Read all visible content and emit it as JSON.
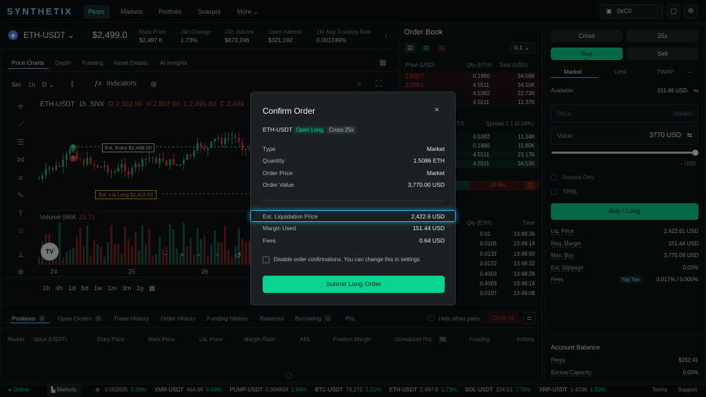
{
  "brand": "SYNTHETIX",
  "nav": [
    "Perps",
    "Markets",
    "Portfolio",
    "Snaxpot",
    "More"
  ],
  "wallet": "0xC0",
  "market": {
    "symbol": "ETH-USDT",
    "price": "$2,499.0",
    "stats": [
      {
        "label": "Mark Price",
        "value": "$2,497.6"
      },
      {
        "label": "24h Change",
        "value": "1.73%"
      },
      {
        "label": "24h Volume",
        "value": "$870,246"
      },
      {
        "label": "Open Interest",
        "value": "$321,192"
      },
      {
        "label": "1hr Avg. Funding Rate",
        "value": "0.001249%"
      }
    ]
  },
  "chart_tabs": [
    "Price Charts",
    "Depth",
    "Funding",
    "Asset Details",
    "AI Insights"
  ],
  "chart_toolbar": {
    "intervals": [
      "5m",
      "1h",
      "D"
    ],
    "indicators": "Indicators"
  },
  "chart_legend": {
    "pair": "ETH-USDT",
    "tf": "1h",
    "ex": "SNX",
    "o": "O 2,502.60",
    "h": "H 2,507.90",
    "l": "L 2,496.60",
    "c": "C 2,499"
  },
  "chart_markers": {
    "entry": "Est. Entry $2,499.00",
    "liq": "Est. Liq Long $2,422.61",
    "b": "B",
    "s": "S"
  },
  "volume_label": "Volume SMA",
  "volume_value": "21.71",
  "date_ticks": [
    "24",
    "25",
    "26"
  ],
  "ranges": [
    "1h",
    "4h",
    "1d",
    "5d",
    "1w",
    "1m",
    "3m",
    "1y"
  ],
  "orderbook": {
    "title": "Order Book",
    "step": "0.1",
    "headers": [
      "Price (USD)",
      "Qty (ETH)",
      "Total (USD)"
    ],
    "asks": [
      [
        "2,500.7",
        "0.1860",
        "34.56K"
      ],
      [
        "2,500.1",
        "4.5511",
        "34.10K"
      ],
      [
        "",
        "4.5382",
        "22.72K"
      ],
      [
        "",
        "4.5511",
        "11.37K"
      ]
    ],
    "spread_left": "7.6",
    "spread": "Spread 1.1 (0.04%)",
    "bids": [
      [
        "",
        "4.5382",
        "11.34K"
      ],
      [
        "",
        "0.1860",
        "11.80K"
      ],
      [
        "",
        "4.5511",
        "23.17K"
      ],
      [
        "",
        "4.5511",
        "34.53K"
      ]
    ],
    "ratio": "49.9%",
    "ratio_label": "S"
  },
  "trades": {
    "headers": [
      "Qty (ETH)",
      "Time"
    ],
    "rows": [
      [
        "0.01",
        "13:49:36"
      ],
      [
        "0.0105",
        "13:49:14"
      ],
      [
        "0.0132",
        "13:48:50"
      ],
      [
        "0.0122",
        "13:48:32"
      ],
      [
        "0.4003",
        "13:48:28"
      ],
      [
        "0.4003",
        "13:48:14"
      ],
      [
        "0.0107",
        "13:49:08"
      ]
    ]
  },
  "order_panel": {
    "margin_mode": "Cross",
    "leverage": "25x",
    "buy": "Buy",
    "sell": "Sell",
    "types": [
      "Market",
      "Limit",
      "TWAP"
    ],
    "available_label": "Available",
    "available": "151.66 USD",
    "price_placeholder": "Price",
    "price_market": "Market",
    "value_label": "Value",
    "value": "3770",
    "value_unit": "USD",
    "slider_unit": "-- USD",
    "reduce_only": "Reduce Only",
    "tpsl": "TP/SL",
    "submit": "Buy / Long",
    "rows": [
      [
        "Liq. Price",
        "2,422.61 USD"
      ],
      [
        "Req. Margin",
        "151.44 USD"
      ],
      [
        "Max. Buy",
        "3,775.09 USD"
      ],
      [
        "Est. Slippage",
        "0.02%"
      ]
    ],
    "fees_label": "Fees",
    "fees_tier": "Top Tier",
    "fees": "0.017% / 0.000%"
  },
  "account": {
    "title": "Account Balance",
    "perps_label": "Perps",
    "perps": "$152.41",
    "borrow_label": "Borrow Capacity",
    "borrow": "0.00%"
  },
  "positions": {
    "tabs": [
      {
        "label": "Positions",
        "count": "0"
      },
      {
        "label": "Open Orders",
        "count": "0"
      },
      {
        "label": "Trade History",
        "count": ""
      },
      {
        "label": "Order History",
        "count": ""
      },
      {
        "label": "Funding History",
        "count": ""
      },
      {
        "label": "Balances",
        "count": ""
      },
      {
        "label": "Borrowing",
        "count": "0"
      },
      {
        "label": "PnL",
        "count": ""
      }
    ],
    "hide_other": "Hide other pairs",
    "close_all": "Close All",
    "columns": [
      "Market",
      "Value (USDT)",
      "Entry Price",
      "Mark Price",
      "Liq. Price",
      "Margin Ratio",
      "ADL",
      "Position Margin",
      "Unrealized PnL",
      "M",
      "Funding",
      "Actions"
    ]
  },
  "footer": {
    "status": "Online",
    "markets": "Markets",
    "tickers": [
      [
        "",
        "0.003905",
        "3.36%"
      ],
      [
        "XMR-USDT",
        "464.66",
        "5.64%"
      ],
      [
        "PUMP-USDT",
        "0.004834",
        "1.94%"
      ],
      [
        "BTC-USDT",
        "79,272",
        "1.21%"
      ],
      [
        "ETH-USDT",
        "2,497.6",
        "1.73%"
      ],
      [
        "SOL-USDT",
        "104.51",
        "7.70%"
      ],
      [
        "XRP-USDT",
        "1.4236",
        "1.32%"
      ]
    ],
    "terms": "Terms",
    "support": "Support"
  },
  "modal": {
    "title": "Confirm Order",
    "pair": "ETH-USDT",
    "side": "Open Long",
    "mode": "Cross 25x",
    "rows": [
      [
        "Type",
        "Market"
      ],
      [
        "Quantity",
        "1.5086 ETH"
      ],
      [
        "Order Price",
        "Market"
      ],
      [
        "Order Value",
        "3,770.00 USD"
      ]
    ],
    "liq_label": "Est. Liquidation Price",
    "liq_value": "2,422.6 USD",
    "rows2": [
      [
        "Margin Used",
        "151.44 USD"
      ],
      [
        "Fees",
        "0.64 USD"
      ]
    ],
    "disable": "Disable order confirmations. You can change this in settings.",
    "submit": "Submit Long Order"
  }
}
